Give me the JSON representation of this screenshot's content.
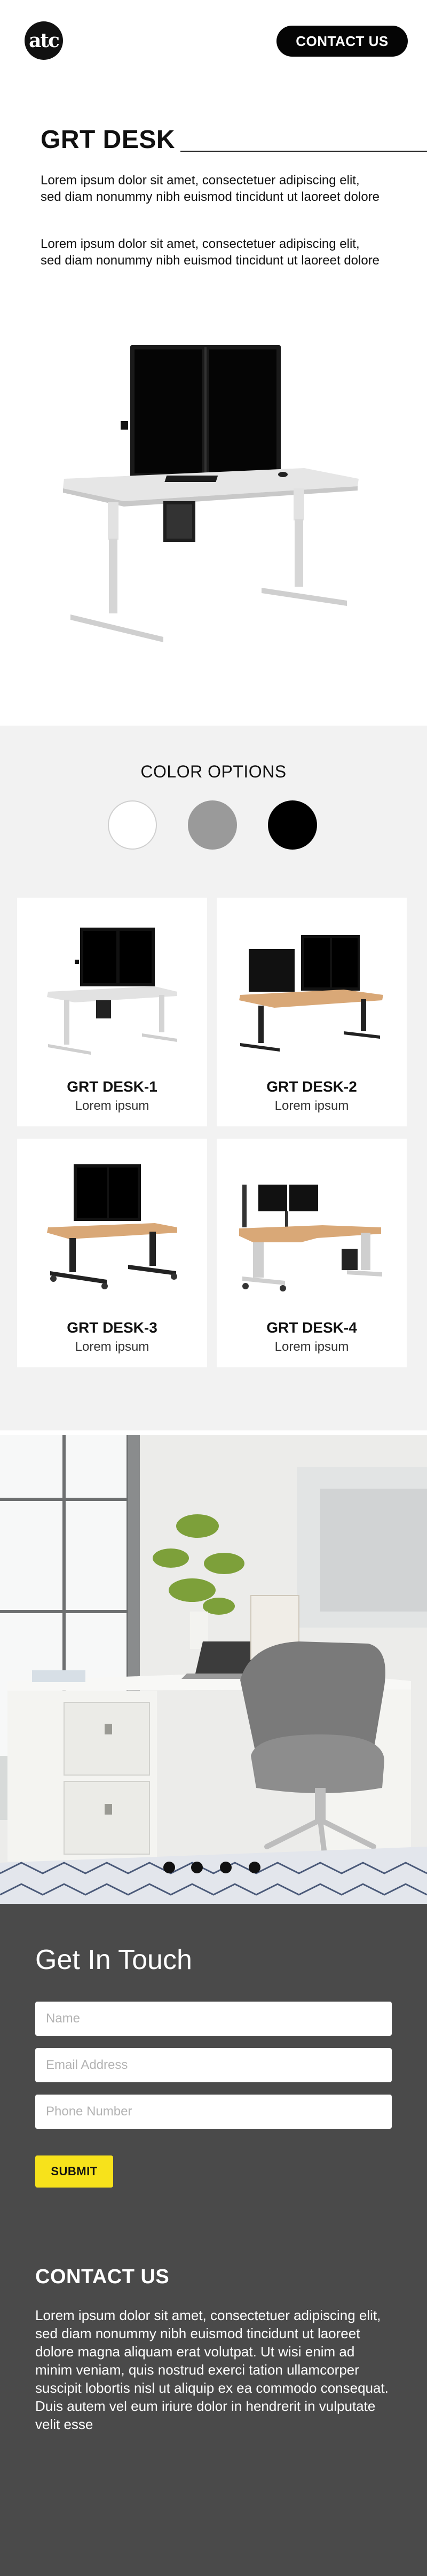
{
  "header": {
    "logo_text": "atc",
    "contact_button": "CONTACT US"
  },
  "hero": {
    "title": "GRT DESK",
    "paragraph_1": "Lorem ipsum dolor sit amet, consectetuer adipiscing elit, sed diam nonummy nibh euismod tincidunt ut laoreet dolore",
    "paragraph_2": "Lorem ipsum dolor sit amet, consectetuer adipiscing elit, sed diam nonummy nibh euismod tincidunt ut laoreet dolore"
  },
  "color_options": {
    "title": "COLOR OPTIONS",
    "swatches": [
      {
        "name": "white",
        "color": "#ffffff"
      },
      {
        "name": "gray",
        "color": "#9a9a9a"
      },
      {
        "name": "black",
        "color": "#000000"
      }
    ]
  },
  "products": [
    {
      "title": "GRT DESK-1",
      "subtitle": "Lorem ipsum"
    },
    {
      "title": "GRT DESK-2",
      "subtitle": "Lorem ipsum"
    },
    {
      "title": "GRT DESK-3",
      "subtitle": "Lorem ipsum"
    },
    {
      "title": "GRT DESK-4",
      "subtitle": "Lorem ipsum"
    }
  ],
  "carousel": {
    "slide_count": 4
  },
  "get_in_touch": {
    "title": "Get In Touch",
    "name_placeholder": "Name",
    "email_placeholder": "Email Address",
    "phone_placeholder": "Phone Number",
    "submit_label": "SUBMIT"
  },
  "contact": {
    "title": "CONTACT US",
    "body": "Lorem ipsum dolor sit amet, consectetuer adipiscing elit, sed diam nonummy nibh euismod tincidunt ut laoreet dolore magna aliquam erat volutpat. Ut wisi enim ad minim veniam, quis nostrud exerci tation ullamcorper suscipit lobortis nisl ut aliquip ex ea commodo consequat. Duis autem vel eum iriure dolor in hendrerit in vulputate velit esse"
  },
  "colors": {
    "accent_yellow": "#f7e21b",
    "contact_background": "#4a4a4a",
    "options_background": "#f2f2f2"
  }
}
